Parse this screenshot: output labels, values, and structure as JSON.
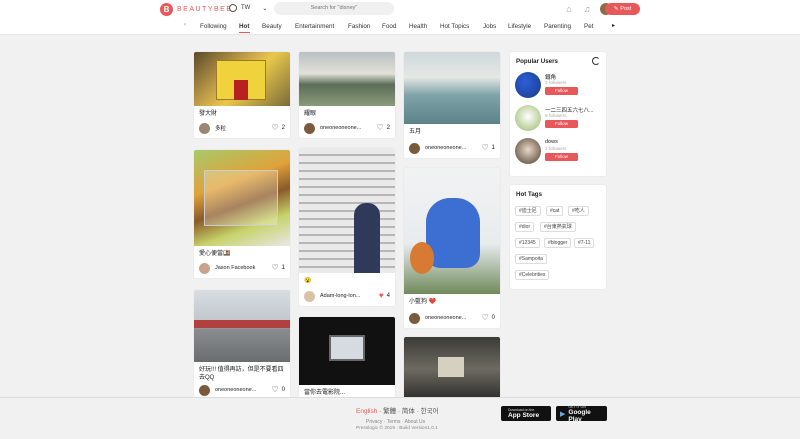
{
  "brand": {
    "name": "BEAUTYBEE",
    "mark": "B"
  },
  "header": {
    "region": "TW",
    "search_placeholder": "Search for \"disney\"",
    "post_label": "Post",
    "post_icon": "✎"
  },
  "nav": {
    "tabs": [
      {
        "label": "Following"
      },
      {
        "label": "Hot"
      },
      {
        "label": "Beauty"
      },
      {
        "label": "Entertainment"
      },
      {
        "label": "Fashion"
      },
      {
        "label": "Food"
      },
      {
        "label": "Health"
      },
      {
        "label": "Hot Topics"
      },
      {
        "label": "Jobs"
      },
      {
        "label": "Lifestyle"
      },
      {
        "label": "Parenting"
      },
      {
        "label": "Pet"
      }
    ],
    "active_tab": "Hot"
  },
  "posts": [
    {
      "title": "發大財",
      "user": "多粒",
      "likes": "2",
      "liked": false
    },
    {
      "title": "愛心便當🍱",
      "user": "Jason Facebook",
      "likes": "1",
      "liked": false
    },
    {
      "title": "好玩!!! 值得再訪，但是不要看四去QQ",
      "user": "oneoneoneone...",
      "likes": "0",
      "liked": false
    },
    {
      "title": "耀眼",
      "user": "oneoneoneone...",
      "likes": "2",
      "liked": false
    },
    {
      "title": "😮",
      "user": "Adam-long-lon...",
      "likes": "4",
      "liked": true
    },
    {
      "title": "當你去電影院...",
      "user": "",
      "likes": "",
      "liked": false
    },
    {
      "title": "五月",
      "user": "oneoneoneone...",
      "likes": "1",
      "liked": false
    },
    {
      "title": "小藍狗 ❤️",
      "user": "oneoneoneone...",
      "likes": "0",
      "liked": false
    }
  ],
  "popular_users": {
    "title": "Popular Users",
    "users": [
      {
        "name": "鐵角",
        "followers": "3 followers",
        "follow_label": "Follow"
      },
      {
        "name": "一二三四五六七八...",
        "followers": "9 followers",
        "follow_label": "Follow"
      },
      {
        "name": "dows",
        "followers": "2 followers",
        "follow_label": "Follow"
      }
    ]
  },
  "hot_tags": {
    "title": "Hot Tags",
    "tags": [
      "#迪士尼",
      "#cat",
      "#吃人",
      "#dior",
      "#台東熱氣球",
      "#12345",
      "#blogger",
      "#7-11",
      "#Sampoita",
      "#Celebrities"
    ]
  },
  "footer": {
    "langs": [
      "English",
      "繁體",
      "简体",
      "한국어"
    ],
    "links": [
      "Privacy",
      "Terms",
      "About Us"
    ],
    "copyright": "Presslogic © 2019 · Build Version1.0.1",
    "appstore": {
      "small": "Download on the",
      "large": "App Store"
    },
    "googleplay": {
      "small": "GET IT ON",
      "large": "Google Play"
    }
  },
  "colors": {
    "accent": "#e8585a",
    "bg": "#f1f1f1"
  }
}
